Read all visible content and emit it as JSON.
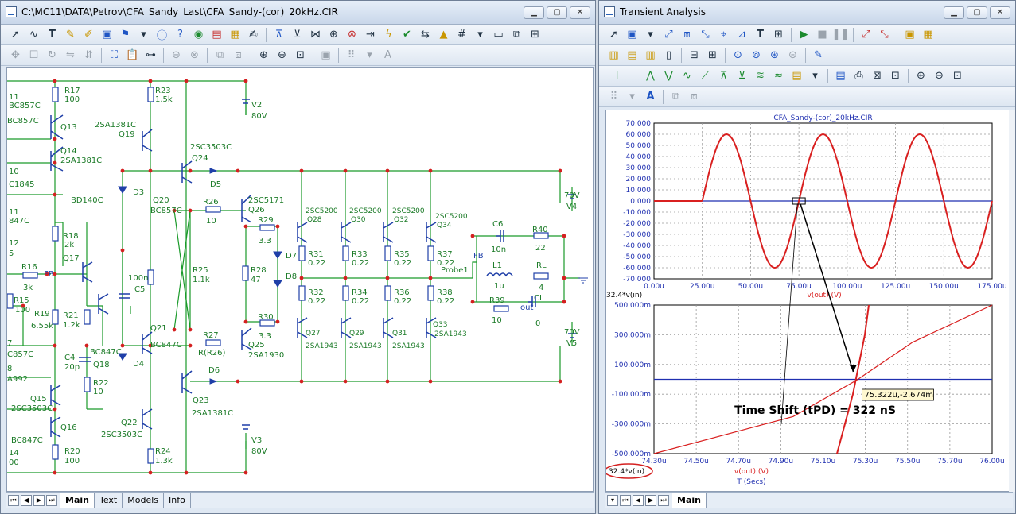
{
  "schematic": {
    "title": "C:\\MC11\\DATA\\Petrov\\CFA_Sandy_Last\\CFA_Sandy-(cor)_20kHz.CIR",
    "tabs": [
      "Main",
      "Text",
      "Models",
      "Info"
    ],
    "active_tab": "Main",
    "components": {
      "r17": "R17",
      "r17v": "100",
      "r23": "R23",
      "r23v": "1.5k",
      "q13": "Q13",
      "bc857c_a": "BC857C",
      "q14": "Q14",
      "sa1381_a": "2SA1381C",
      "v2": "V2",
      "v2v": "80V",
      "sa1381_b": "2SA1381C",
      "q19": "Q19",
      "sc3503_a": "2SC3503C",
      "q24": "Q24",
      "d5": "D5",
      "d3": "D3",
      "bd140": "BD140C",
      "q20": "Q20",
      "bc857c_b": "BC857C",
      "r26": "R26",
      "r26v": "10",
      "sc5171": "2SC5171",
      "q26": "Q26",
      "r29": "R29",
      "r29v": "3.3",
      "sc5200_1": "2SC5200",
      "q28": "Q28",
      "sc5200_2": "2SC5200",
      "q30": "Q30",
      "sc5200_3": "2SC5200",
      "q32": "Q32",
      "sc5200_4": "2SC5200",
      "q34": "Q34",
      "v4v": "70V",
      "v4": "V4",
      "c6": "C6",
      "c6v": "10n",
      "r40": "R40",
      "r40v": "22",
      "r18": "R18",
      "r18v": "2k",
      "q17": "Q17",
      "r16": "R16",
      "r16v": "3k",
      "fb1": "FB",
      "c5v": "100n",
      "c5": "C5",
      "r25": "R25",
      "r25v": "1.1k",
      "r28": "R28",
      "r28v": "47",
      "d7": "D7",
      "d8": "D8",
      "r31": "R31",
      "r31v": "0.22",
      "r33": "R33",
      "r33v": "0.22",
      "r35": "R35",
      "r35v": "0.22",
      "r37": "R37",
      "r37v": "0.22",
      "fb2": "FB",
      "l1": "L1",
      "l1v": "1u",
      "rl": "RL",
      "rlv": "4",
      "probe1": "Probe1",
      "r15": "R15",
      "r15v": "100",
      "r19": "R19",
      "r19v": "6.55k",
      "r21": "R21",
      "r21v": "1.2k",
      "r32": "R32",
      "r32v": "0.22",
      "r34": "R34",
      "r34v": "0.22",
      "r36": "R36",
      "r36v": "0.22",
      "r38": "R38",
      "r38v": "0.22",
      "r39": "R39",
      "r39v": "10",
      "out": "out",
      "cl": "CL",
      "clv": "0",
      "q21": "Q21",
      "bc847c_a": "BC847C",
      "r27": "R27",
      "r27v": "R(R26)",
      "q25": "Q25",
      "sa1930": "2SA1930",
      "r30": "R30",
      "r30v": "3.3",
      "q27": "Q27",
      "q29": "Q29",
      "q31": "Q31",
      "q33": "Q33",
      "sa1943_1": "2SA1943",
      "sa1943_2": "2SA1943",
      "sa1943_3": "2SA1943",
      "sa1943_4": "2SA1943",
      "v5v": "70V",
      "v5": "V5",
      "c4": "C4",
      "c4v": "20p",
      "bc847c_b": "BC847C",
      "q18": "Q18",
      "r22": "R22",
      "r22v": "10",
      "d4": "D4",
      "d6": "D6",
      "q23": "Q23",
      "sa1381_c": "2SA1381C",
      "q15": "Q15",
      "sc3503_b": "2SC3503C",
      "q22": "Q22",
      "sc3503_c": "2SC3503C",
      "q16": "Q16",
      "bc847c_c": "BC847C",
      "r20": "R20",
      "r20v": "100",
      "r24": "R24",
      "r24v": "1.3k",
      "v3": "V3",
      "v3v": "80V",
      "edge_11a": "11",
      "edge_10": "10",
      "edge_c1845": "C1845",
      "edge_11b": "11",
      "edge_847c": "847C",
      "edge_12": "12",
      "edge_5": "5",
      "edge_857c": "C857C",
      "edge_7": "7",
      "edge_8": "8",
      "edge_a992": "A992",
      "edge_14": "14",
      "edge_00": "00",
      "edge_bc857c": "BC857C"
    }
  },
  "analysis": {
    "title": "Transient Analysis",
    "tabs": [
      "Main"
    ],
    "active_tab": "Main",
    "annotation_point": "75.322u,-2.674m",
    "annotation_text": "Time Shift (tPD) = 322 nS",
    "colors": {
      "series_out": "#d92020",
      "series_in": "#1f2fb0",
      "grid": "#9a9a9a"
    }
  },
  "chart_data": [
    {
      "type": "line",
      "title": "CFA_Sandy-(cor)_20kHz.CIR",
      "xlabel": "",
      "ylabel": "",
      "x_ticks": [
        "0.00u",
        "25.00u",
        "50.00u",
        "75.00u",
        "100.00u",
        "125.00u",
        "150.00u",
        "175.00u"
      ],
      "y_ticks": [
        "70.000",
        "60.000",
        "50.000",
        "40.000",
        "30.000",
        "20.000",
        "10.000",
        "0.000",
        "-10.000",
        "-20.000",
        "-30.000",
        "-40.000",
        "-50.000",
        "-60.000",
        "-70.000"
      ],
      "xlim": [
        0,
        175
      ],
      "ylim": [
        -70,
        70
      ],
      "grid": true,
      "series": [
        {
          "name": "v(out) (V)",
          "points": [
            [
              0,
              0
            ],
            [
              25,
              0
            ],
            [
              37.5,
              60
            ],
            [
              50,
              0
            ],
            [
              62.5,
              -60
            ],
            [
              75,
              0
            ],
            [
              87.5,
              60
            ],
            [
              100,
              0
            ],
            [
              112.5,
              -60
            ],
            [
              125,
              0
            ],
            [
              137.5,
              60
            ],
            [
              150,
              0
            ],
            [
              162.5,
              -60
            ],
            [
              175,
              0
            ]
          ]
        },
        {
          "name": "32.4*v(in)",
          "points": [
            [
              0,
              0
            ],
            [
              175,
              0
            ]
          ]
        }
      ],
      "cursor_box_x": 75
    },
    {
      "type": "line",
      "title": "",
      "xlabel": "T (Secs)",
      "x_ticks": [
        "74.30u",
        "74.50u",
        "74.70u",
        "74.90u",
        "75.10u",
        "75.30u",
        "75.50u",
        "75.70u",
        "76.00u"
      ],
      "y_ticks": [
        "500.000m",
        "300.000m",
        "100.000m",
        "-100.000m",
        "-300.000m",
        "-500.000m"
      ],
      "xlim": [
        74.3,
        76.0
      ],
      "ylim": [
        -500,
        500
      ],
      "grid": true,
      "series": [
        {
          "name": "v(out) (V)",
          "points": [
            [
              75.22,
              -500
            ],
            [
              75.3,
              -100
            ],
            [
              75.36,
              300
            ],
            [
              75.38,
              500
            ]
          ]
        },
        {
          "name": "32.4*v(in)",
          "points": [
            [
              74.3,
              -500
            ],
            [
              75.0,
              -250
            ],
            [
              75.322,
              -2.674
            ],
            [
              75.6,
              250
            ],
            [
              76.0,
              500
            ]
          ]
        },
        {
          "name": "32.4*v(in) (blue baseline)",
          "points": [
            [
              74.3,
              0
            ],
            [
              76.0,
              0
            ]
          ]
        }
      ],
      "legend": [
        "32.4*v(in)",
        "v(out) (V)"
      ]
    }
  ]
}
